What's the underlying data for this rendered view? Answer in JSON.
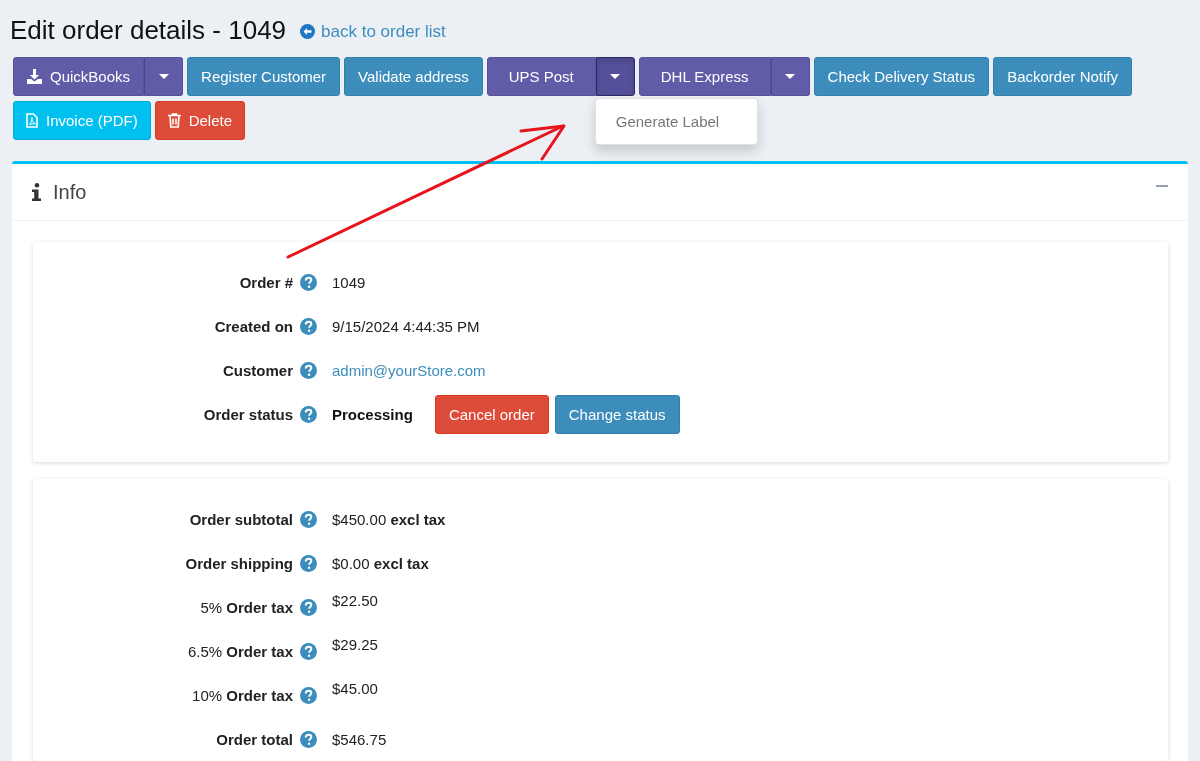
{
  "page": {
    "title": "Edit order details - 1049",
    "back_link": "back to order list"
  },
  "toolbar": [
    {
      "buttons": [
        {
          "label": "QuickBooks",
          "kind": "export",
          "expanded": false
        },
        {
          "label": "Register Customer",
          "kind": "plain"
        },
        {
          "label": "Validate address",
          "kind": "plain"
        },
        {
          "label": "UPS Post",
          "kind": "split",
          "expanded": true,
          "menu": [
            "Generate Label"
          ]
        },
        {
          "label": "DHL Express",
          "kind": "split",
          "expanded": false
        },
        {
          "label": "Check Delivery Status",
          "kind": "plain"
        },
        {
          "label": "Backorder Notify",
          "kind": "plain"
        }
      ]
    },
    {
      "buttons": [
        {
          "label": "Invoice (PDF)",
          "kind": "invoice"
        },
        {
          "label": "Delete",
          "kind": "delete"
        }
      ]
    }
  ],
  "info_card": {
    "title": "Info",
    "expanded": true,
    "details": [
      {
        "label": "Order #",
        "value": "1049",
        "kind": "text"
      },
      {
        "label": "Created on",
        "value": "9/15/2024 4:44:35 PM",
        "kind": "text"
      },
      {
        "label": "Customer",
        "value": "admin@yourStore.com",
        "kind": "link"
      },
      {
        "label": "Order status",
        "value": "Processing",
        "kind": "status",
        "buttons": [
          {
            "label": "Cancel order",
            "kind": "danger"
          },
          {
            "label": "Change status",
            "kind": "primary"
          }
        ]
      }
    ],
    "totals": [
      {
        "label": "Order subtotal",
        "value": "$450.00 **excl tax**",
        "kind": "amount"
      },
      {
        "label": "Order shipping",
        "value": "$0.00 **excl tax**",
        "kind": "amount"
      },
      {
        "rate": "5%",
        "label": "Order tax",
        "value": "$22.50",
        "kind": "tax"
      },
      {
        "rate": "6.5%",
        "label": "Order tax",
        "value": "$29.25",
        "kind": "tax"
      },
      {
        "rate": "10%",
        "label": "Order tax",
        "value": "$45.00",
        "kind": "tax"
      },
      {
        "label": "Order total",
        "value": "$546.75",
        "kind": "amount"
      }
    ]
  }
}
